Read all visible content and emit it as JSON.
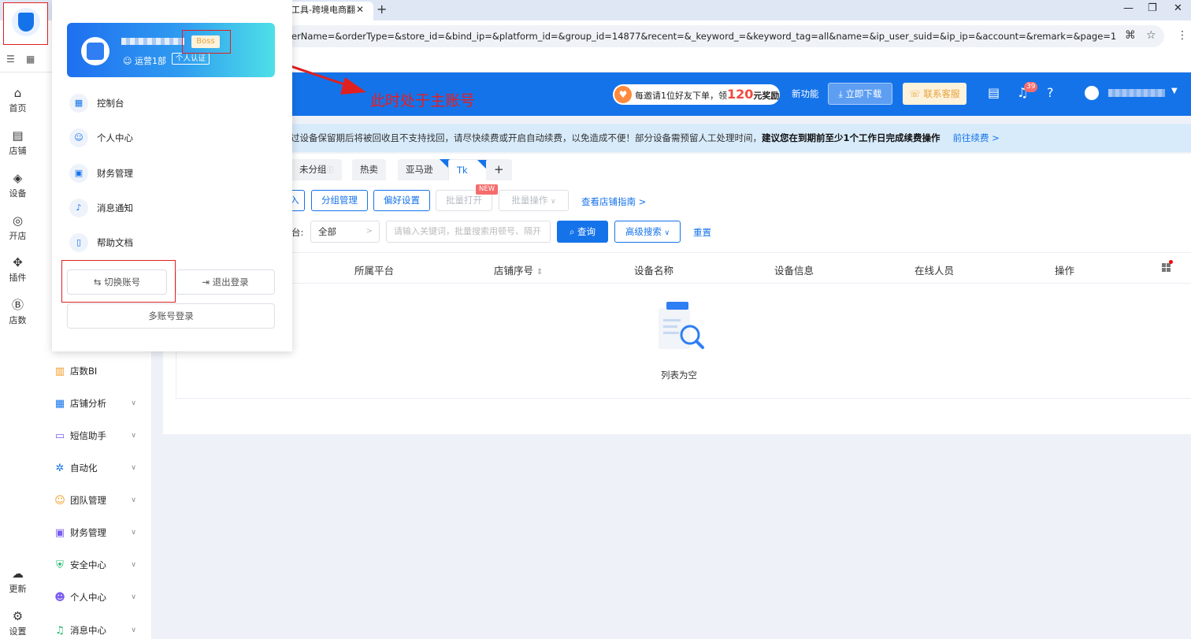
{
  "browser": {
    "tab_title": "工具-跨境电商翻",
    "url": "erName=&orderType=&store_id=&bind_ip=&platform_id=&group_id=14877&recent=&_keyword_=&keyword_tag=all&name=&ip_user_suid=&ip_ip=&account=&remark=&page=1",
    "close_tab": "✕",
    "new_tab": "+",
    "win_min": "—",
    "win_restore": "❐",
    "win_close": "✕"
  },
  "rail": [
    {
      "icon": "⌂",
      "label": "首页"
    },
    {
      "icon": "▤",
      "label": "店铺"
    },
    {
      "icon": "◈",
      "label": "设备"
    },
    {
      "icon": "◎",
      "label": "开店"
    },
    {
      "icon": "✥",
      "label": "插件"
    },
    {
      "icon": "Ⓑ",
      "label": "店数"
    }
  ],
  "rail_bottom": [
    {
      "icon": "☁",
      "label": "更新"
    },
    {
      "icon": "⚙",
      "label": "设置"
    }
  ],
  "sidebar": [
    {
      "icon": "▥",
      "label": "店数BI",
      "color": "#f59a23"
    },
    {
      "icon": "▦",
      "label": "店铺分析",
      "color": "#1573ea"
    },
    {
      "icon": "▭",
      "label": "短信助手",
      "color": "#7b5cf0"
    },
    {
      "icon": "✲",
      "label": "自动化",
      "color": "#1573ea"
    },
    {
      "icon": "☺",
      "label": "团队管理",
      "color": "#f59a23"
    },
    {
      "icon": "▣",
      "label": "财务管理",
      "color": "#7b5cf0"
    },
    {
      "icon": "⛨",
      "label": "安全中心",
      "color": "#19b36b"
    },
    {
      "icon": "☻",
      "label": "个人中心",
      "color": "#7b5cf0"
    },
    {
      "icon": "♫",
      "label": "消息中心",
      "color": "#19b36b"
    }
  ],
  "header": {
    "promo_pre": "每邀请1位好友下单，领",
    "promo_amount": "120",
    "promo_post": "元奖励",
    "new_feature": "新功能",
    "download": "立即下载",
    "support": "联系客服",
    "notif_count": "39"
  },
  "annotation": "此时处于主账号",
  "notice": {
    "text": "过设备保留期后将被回收且不支持找回，请尽快续费或开启自动续费，以免造成不便！部分设备需预留人工处理时间，",
    "bold": "建议您在到期前至少1个工作日完成续费操作",
    "link": "前往续费 >"
  },
  "group_tabs": [
    "未分组",
    "热卖",
    "亚马逊",
    "Tk",
    "+"
  ],
  "toolbar": {
    "btn_partial": "入",
    "group_manage": "分组管理",
    "pref": "偏好设置",
    "batch_open": "批量打开",
    "new_tag": "NEW",
    "batch_op": "批量操作",
    "guide": "查看店铺指南 >"
  },
  "filter": {
    "platform_label": "台:",
    "platform_value": "全部",
    "keyword_placeholder": "请输入关键词，批量搜索用顿号、隔开",
    "query": "查询",
    "advanced": "高级搜索",
    "reset": "重置"
  },
  "table": {
    "columns": [
      "所属平台",
      "店铺序号",
      "设备名称",
      "设备信息",
      "在线人员",
      "操作"
    ],
    "empty": "列表为空"
  },
  "popup": {
    "boss": "Boss",
    "dept": "运营1部",
    "verify": "个人认证",
    "items": [
      {
        "icon": "▦",
        "label": "控制台"
      },
      {
        "icon": "☺",
        "label": "个人中心"
      },
      {
        "icon": "▣",
        "label": "财务管理"
      },
      {
        "icon": "♪",
        "label": "消息通知"
      },
      {
        "icon": "▯",
        "label": "帮助文档"
      }
    ],
    "switch": "⇆ 切换账号",
    "logout": "⇥ 退出登录",
    "multi": "多账号登录"
  }
}
